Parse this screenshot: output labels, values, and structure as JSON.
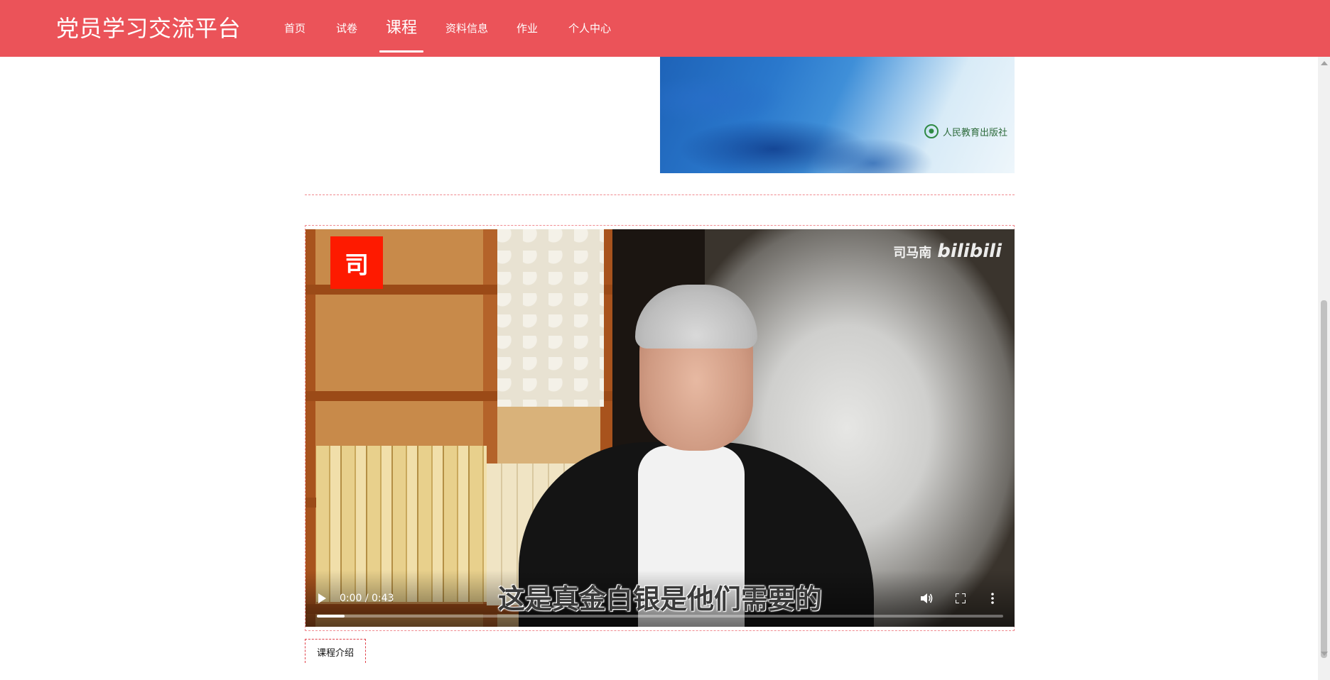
{
  "header": {
    "brand": "党员学习交流平台",
    "nav": [
      {
        "label": "首页",
        "active": false
      },
      {
        "label": "试卷",
        "active": false
      },
      {
        "label": "课程",
        "active": true
      },
      {
        "label": "资料信息",
        "active": false
      },
      {
        "label": "作业",
        "active": false
      },
      {
        "label": "个人中心",
        "active": false
      }
    ],
    "colors": {
      "background": "#eb5359",
      "text": "#ffffff"
    }
  },
  "cover": {
    "publisher": "人民教育出版社"
  },
  "video": {
    "logo_char": "司",
    "watermark_name": "司马南",
    "watermark_site": "bilibili",
    "subtitle": "这是真金白银是他们需要的",
    "time": "0:00 / 0:43",
    "progress": 0.04,
    "icons": [
      "play-icon",
      "volume-icon",
      "fullscreen-icon",
      "more-options-icon"
    ]
  },
  "tabs": {
    "intro_label": "课程介绍"
  }
}
